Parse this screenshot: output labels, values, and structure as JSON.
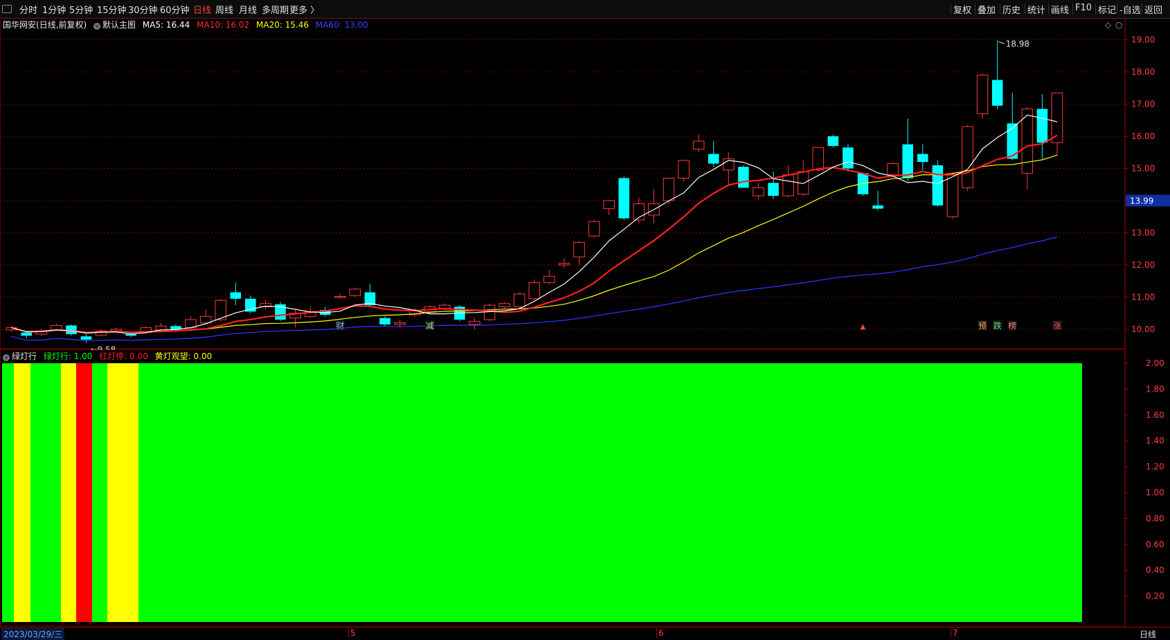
{
  "toolbar": {
    "left": [
      "分时",
      "1分钟",
      "5分钟",
      "15分钟",
      "30分钟",
      "60分钟",
      "日线",
      "周线",
      "月线",
      "多周期",
      "更多 〉"
    ],
    "active": "日线",
    "right": [
      "复权",
      "叠加",
      "历史",
      "统计",
      "画线",
      "F10",
      "标记",
      "-自选",
      "返回"
    ]
  },
  "main_header": {
    "stock": "国华网安",
    "period": "(日线,前复权)",
    "template": "默认主图",
    "ma5": "MA5: 16.44",
    "ma10": "MA10: 16.02",
    "ma20": "MA20: 15.46",
    "ma60": "MA60: 13.00"
  },
  "price_axis": {
    "ticks": [
      "19.00",
      "18.00",
      "17.00",
      "16.00",
      "15.00",
      "13.00",
      "12.00",
      "11.00",
      "10.00"
    ],
    "current_price": "13.99"
  },
  "annotations": {
    "high": "18.98",
    "low": "←9.58",
    "events": [
      {
        "label": "财",
        "color": "#8ab4ff"
      },
      {
        "label": "减",
        "color": "#9fe79f"
      },
      {
        "label": "预",
        "color": "#ffb040"
      },
      {
        "label": "跌",
        "color": "#6fdc6f"
      },
      {
        "label": "榜",
        "color": "#ff8080"
      },
      {
        "label": "涨",
        "color": "#ff5050"
      }
    ]
  },
  "indicator": {
    "name": "绿灯行",
    "green": "绿灯行: 1.00",
    "red": "红灯停: 0.00",
    "yellow": "黄灯观望: 0.00",
    "ticks": [
      "2.00",
      "1.80",
      "1.60",
      "1.40",
      "1.20",
      "1.00",
      "0.80",
      "0.60",
      "0.40",
      "0.20"
    ]
  },
  "date_axis": {
    "first_date": "2023/03/29/三",
    "months": [
      "5",
      "6",
      "7"
    ],
    "period_label": "日线"
  },
  "colors": {
    "up": "#ff3b3b",
    "down": "#00ffff",
    "ma5": "#ffffff",
    "ma10": "#ff2020",
    "ma20": "#ffff00",
    "ma60": "#3030ff",
    "green_light": "#00ff00",
    "yellow_light": "#ffff00",
    "red_light": "#ff0000"
  },
  "chart_data": {
    "type": "candlestick",
    "ylim": [
      9.3,
      19.3
    ],
    "candles": [
      [
        9.98,
        10.05,
        10.1,
        9.92
      ],
      [
        9.9,
        9.8,
        9.95,
        9.72
      ],
      [
        9.85,
        9.95,
        10.0,
        9.8
      ],
      [
        9.98,
        10.12,
        10.18,
        9.95
      ],
      [
        10.12,
        9.85,
        10.15,
        9.8
      ],
      [
        9.78,
        9.68,
        9.85,
        9.58
      ],
      [
        9.82,
        9.95,
        10.0,
        9.78
      ],
      [
        9.95,
        10.0,
        10.05,
        9.9
      ],
      [
        9.85,
        9.8,
        9.9,
        9.75
      ],
      [
        9.9,
        10.05,
        10.1,
        9.85
      ],
      [
        9.98,
        10.1,
        10.2,
        9.95
      ],
      [
        10.1,
        10.0,
        10.15,
        9.95
      ],
      [
        10.05,
        10.3,
        10.4,
        10.0
      ],
      [
        10.2,
        10.4,
        10.6,
        10.15
      ],
      [
        10.3,
        10.9,
        10.95,
        10.25
      ],
      [
        11.15,
        10.95,
        11.45,
        10.75
      ],
      [
        10.95,
        10.55,
        11.05,
        10.5
      ],
      [
        10.7,
        10.8,
        10.9,
        10.6
      ],
      [
        10.78,
        10.3,
        10.85,
        10.25
      ],
      [
        10.35,
        10.5,
        10.6,
        10.05
      ],
      [
        10.4,
        10.55,
        10.7,
        10.35
      ],
      [
        10.6,
        10.45,
        10.7,
        10.4
      ],
      [
        11.0,
        11.02,
        11.1,
        10.95
      ],
      [
        11.05,
        11.25,
        11.3,
        11.0
      ],
      [
        11.15,
        10.75,
        11.4,
        10.7
      ],
      [
        10.35,
        10.15,
        10.4,
        10.1
      ],
      [
        10.15,
        10.2,
        10.3,
        10.05
      ],
      [
        10.45,
        10.6,
        10.65,
        10.4
      ],
      [
        10.55,
        10.7,
        10.75,
        10.5
      ],
      [
        10.65,
        10.75,
        10.8,
        10.6
      ],
      [
        10.7,
        10.3,
        10.75,
        10.25
      ],
      [
        10.15,
        10.25,
        10.35,
        10.0
      ],
      [
        10.3,
        10.75,
        10.8,
        10.25
      ],
      [
        10.7,
        10.8,
        10.85,
        10.65
      ],
      [
        10.7,
        11.1,
        11.15,
        10.65
      ],
      [
        10.95,
        11.45,
        11.55,
        10.9
      ],
      [
        11.45,
        11.65,
        11.85,
        11.4
      ],
      [
        12.0,
        12.05,
        12.2,
        11.9
      ],
      [
        12.25,
        12.7,
        12.75,
        12.0
      ],
      [
        12.9,
        13.35,
        13.4,
        12.85
      ],
      [
        13.75,
        14.0,
        14.0,
        13.55
      ],
      [
        14.7,
        13.45,
        14.75,
        13.4
      ],
      [
        13.4,
        13.9,
        14.1,
        13.3
      ],
      [
        13.55,
        13.9,
        14.35,
        13.3
      ],
      [
        14.0,
        14.7,
        14.7,
        13.9
      ],
      [
        14.7,
        15.25,
        15.25,
        14.6
      ],
      [
        15.6,
        15.85,
        16.05,
        15.5
      ],
      [
        15.45,
        15.15,
        15.85,
        15.05
      ],
      [
        14.95,
        15.3,
        15.5,
        14.45
      ],
      [
        15.05,
        14.4,
        15.1,
        14.4
      ],
      [
        14.15,
        14.4,
        14.55,
        14.05
      ],
      [
        14.55,
        14.15,
        14.9,
        14.05
      ],
      [
        14.15,
        14.8,
        15.1,
        14.1
      ],
      [
        14.2,
        14.9,
        15.25,
        14.15
      ],
      [
        14.95,
        15.65,
        15.65,
        14.9
      ],
      [
        16.0,
        15.7,
        16.05,
        15.65
      ],
      [
        15.65,
        15.0,
        15.75,
        14.9
      ],
      [
        14.85,
        14.2,
        14.85,
        14.15
      ],
      [
        13.85,
        13.75,
        14.3,
        13.7
      ],
      [
        14.8,
        15.15,
        15.2,
        14.75
      ],
      [
        15.75,
        14.7,
        16.55,
        14.6
      ],
      [
        15.45,
        15.2,
        15.75,
        14.95
      ],
      [
        15.1,
        13.85,
        15.25,
        13.8
      ],
      [
        13.5,
        14.8,
        14.9,
        13.45
      ],
      [
        14.4,
        16.3,
        16.35,
        14.3
      ],
      [
        16.7,
        17.9,
        17.95,
        16.55
      ],
      [
        17.75,
        16.95,
        18.98,
        16.85
      ],
      [
        16.4,
        15.3,
        17.35,
        15.25
      ],
      [
        14.85,
        16.85,
        16.9,
        14.35
      ],
      [
        16.85,
        15.8,
        17.3,
        15.3
      ],
      [
        15.8,
        17.35,
        17.35,
        15.4
      ]
    ]
  }
}
